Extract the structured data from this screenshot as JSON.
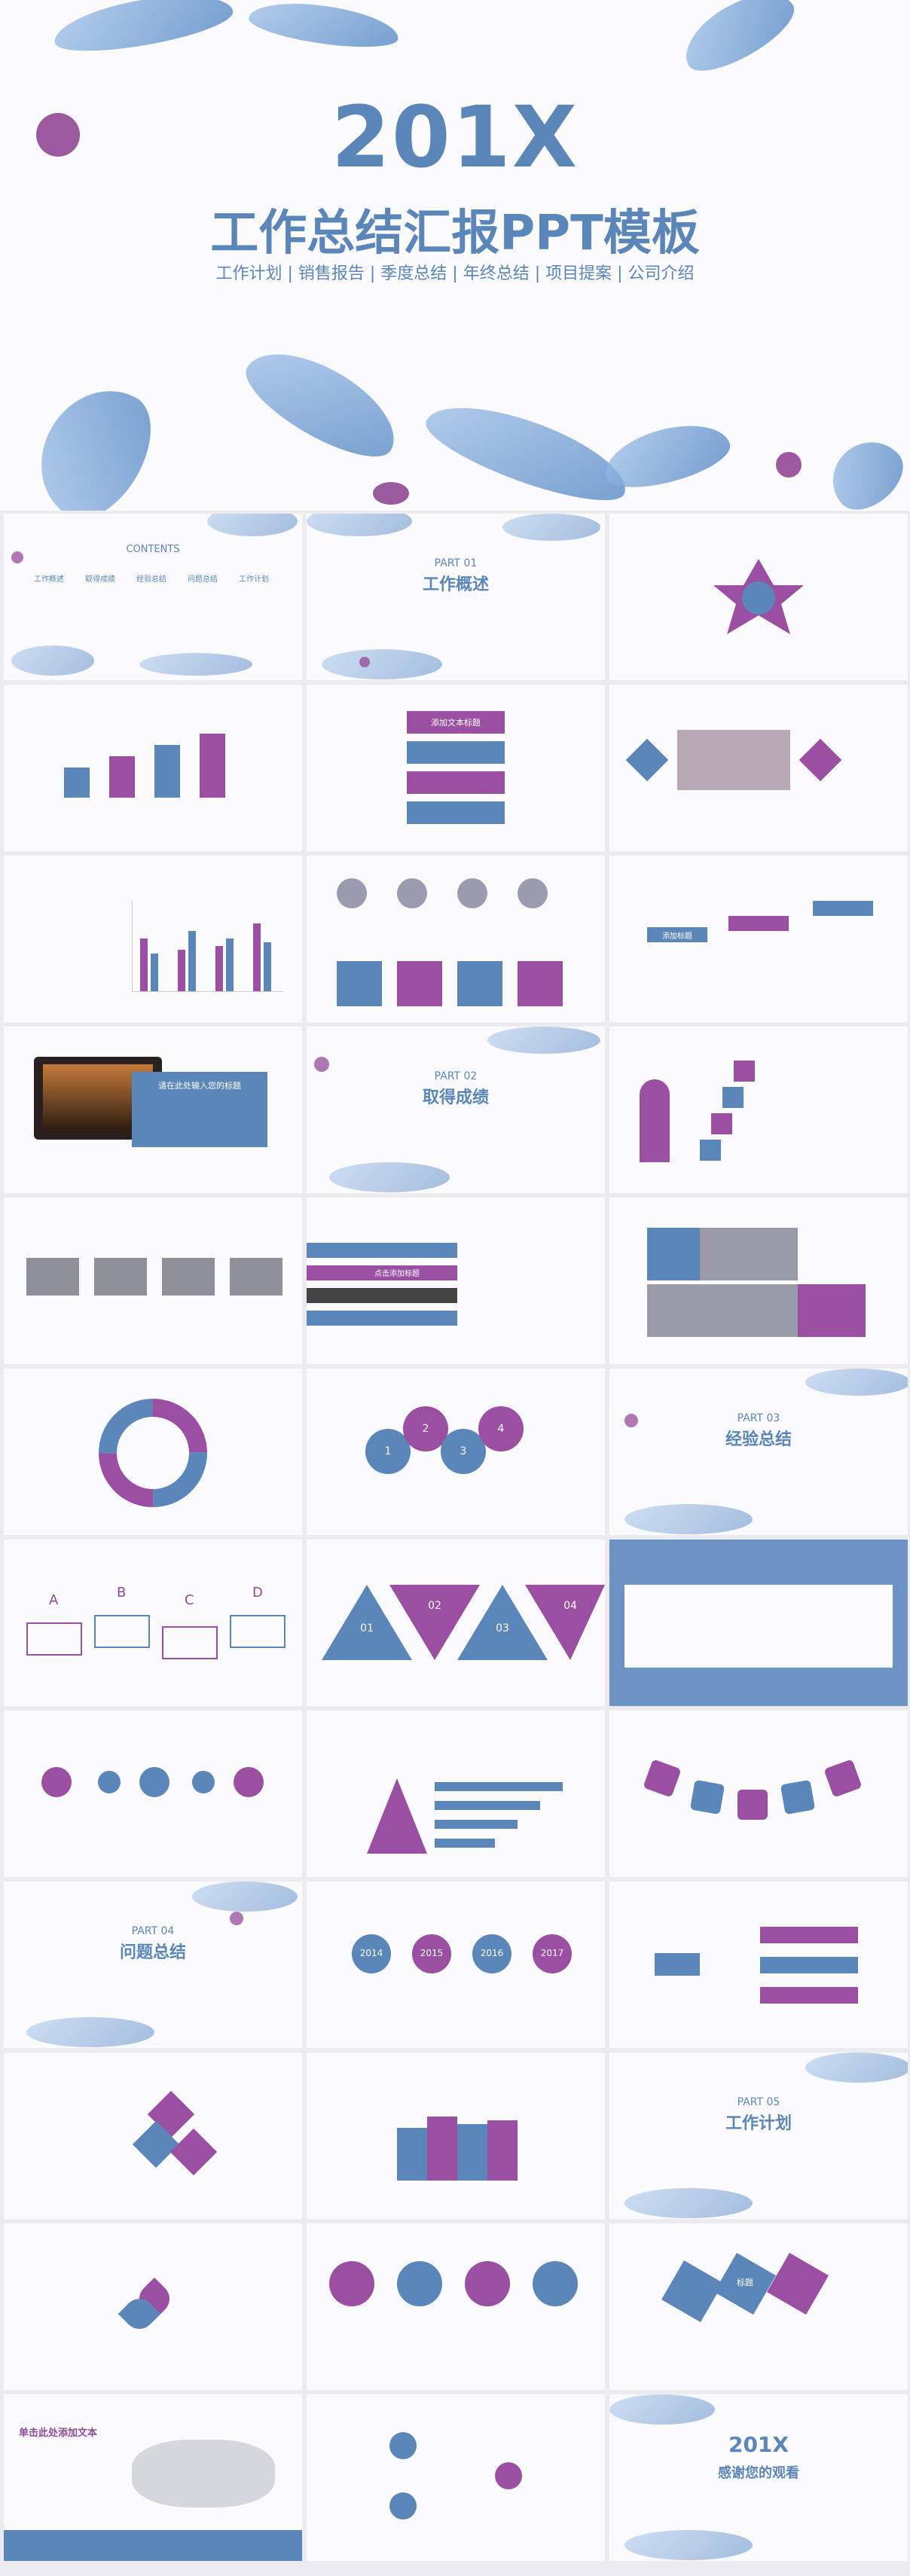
{
  "cover": {
    "year": "201X",
    "title": "工作总结汇报PPT模板",
    "subtitle": "工作计划 | 销售报告 | 季度总结 | 年终总结 | 项目提案 | 公司介绍"
  },
  "contents": {
    "heading": "CONTENTS",
    "items": [
      "工作概述",
      "取得成绩",
      "经验总结",
      "问题总结",
      "工作计划"
    ]
  },
  "part01": {
    "label": "PART 01",
    "title": "工作概述"
  },
  "part02": {
    "label": "PART 02",
    "title": "取得成绩"
  },
  "part03": {
    "label": "PART 03",
    "title": "经验总结"
  },
  "part04": {
    "label": "PART 04",
    "title": "问题总结"
  },
  "part05": {
    "label": "PART 05",
    "title": "工作计划"
  },
  "add_text_title": "添加文本标题",
  "add_title": "添加标题",
  "click_add_title": "点击添加标题",
  "laptop_caption": "请在此处输入您的标题",
  "years": [
    "2014",
    "2015",
    "2016",
    "2017"
  ],
  "abcd": [
    "A",
    "B",
    "C",
    "D"
  ],
  "nums": [
    "01",
    "02",
    "03",
    "04"
  ],
  "steps": [
    "1",
    "2",
    "3",
    "4"
  ],
  "title_label": "标题",
  "click_add_text": "单击此处添加文本",
  "closing": {
    "year": "201X",
    "thanks": "感谢您的观看"
  },
  "colors": {
    "blue": "#5b86b9",
    "purple": "#9a4fa2",
    "bg": "#fbfafd"
  }
}
